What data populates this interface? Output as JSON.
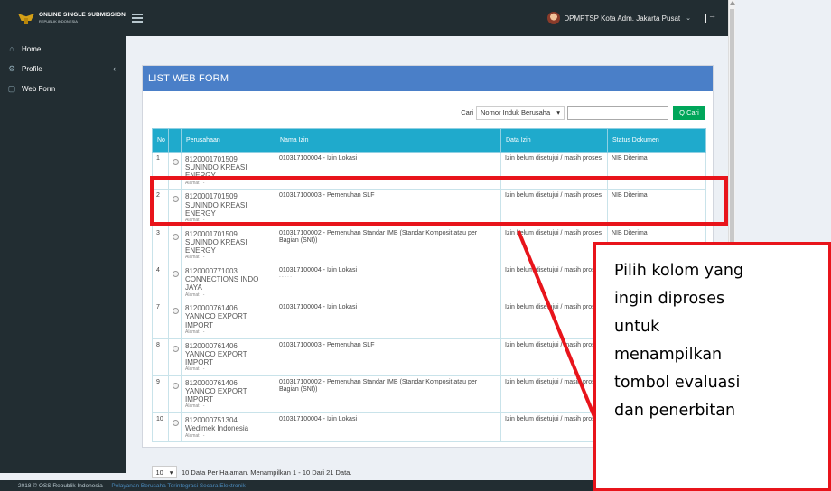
{
  "navbar": {
    "brand_title": "ONLINE SINGLE SUBMISSION",
    "brand_subtitle": "REPUBLIK INDONESIA",
    "user_name": "DPMPTSP Kota Adm. Jakarta Pusat",
    "caret": "⌄"
  },
  "sidebar": {
    "items": [
      {
        "label": "Home",
        "icon": "home-icon"
      },
      {
        "label": "Profile",
        "icon": "gear-icon"
      },
      {
        "label": "Web Form",
        "icon": "form-icon"
      }
    ]
  },
  "panel": {
    "title": "LIST WEB FORM"
  },
  "search": {
    "label": "Cari",
    "select_value": "Nomor Induk Berusaha",
    "input_value": "",
    "button_label": "Q Cari"
  },
  "table": {
    "headers": {
      "no": "No",
      "perusahaan": "Perusahaan",
      "nama_izin": "Nama Izin",
      "data_izin": "Data Izin",
      "status": "Status Dokumen"
    },
    "rows": [
      {
        "no": "1",
        "nib": "8120001701509",
        "name": "SUNINDO KREASI ENERGY",
        "alamat": "Alamat : -",
        "izin": "010317100004 - Izin Lokasi",
        "extra": "",
        "data_izin": "Izin belum disetujui / masih proses",
        "status": "NIB Diterima"
      },
      {
        "no": "2",
        "nib": "8120001701509",
        "name": "SUNINDO KREASI ENERGY",
        "alamat": "Alamat : -",
        "izin": "010317100003 - Pemenuhan SLF",
        "extra": "",
        "data_izin": "Izin belum disetujui / masih proses",
        "status": "NIB Diterima"
      },
      {
        "no": "3",
        "nib": "8120001701509",
        "name": "SUNINDO KREASI ENERGY",
        "alamat": "Alamat : -",
        "izin": "010317100002 - Pemenuhan Standar IMB (Standar Komposit atau per Bagian (SNI))",
        "extra": "",
        "data_izin": "Izin belum disetujui / masih proses",
        "status": "NIB Diterima"
      },
      {
        "no": "4",
        "nib": "8120000771003",
        "name": "CONNECTIONS INDO JAYA",
        "alamat": "Alamat : -",
        "izin": "010317100004 - Izin Lokasi",
        "extra": "- - - · ·",
        "data_izin": "Izin belum disetujui / masih proses",
        "status": ""
      },
      {
        "no": "7",
        "nib": "8120000761406",
        "name": "YANNCO EXPORT IMPORT",
        "alamat": "Alamat : -",
        "izin": "010317100004 - Izin Lokasi",
        "extra": "",
        "data_izin": "Izin belum disetujui / masih proses",
        "status": ""
      },
      {
        "no": "8",
        "nib": "8120000761406",
        "name": "YANNCO EXPORT IMPORT",
        "alamat": "Alamat : -",
        "izin": "010317100003 - Pemenuhan SLF",
        "extra": "",
        "data_izin": "Izin belum disetujui / masih proses",
        "status": ""
      },
      {
        "no": "9",
        "nib": "8120000761406",
        "name": "YANNCO EXPORT IMPORT",
        "alamat": "Alamat : -",
        "izin": "010317100002 - Pemenuhan Standar IMB (Standar Komposit atau per Bagian (SNI))",
        "extra": "",
        "data_izin": "Izin belum disetujui / masih proses",
        "status": ""
      },
      {
        "no": "10",
        "nib": "8120000751304",
        "name": "Wedimek Indonesia",
        "alamat": "Alamat : -",
        "izin": "010317100004 - Izin Lokasi",
        "extra": "",
        "data_izin": "Izin belum disetujui / masih proses",
        "status": ""
      }
    ]
  },
  "pager": {
    "page_size": "10",
    "caret": "▾",
    "summary": "10 Data Per Halaman. Menampilkan 1 - 10 Dari 21 Data.",
    "nav": "« ‹"
  },
  "footer": {
    "copyright": "2018 © OSS Republik Indonesia",
    "separator": "|",
    "link": "Pelayanan Berusaha Terintegrasi Secara Elektronik"
  },
  "annotation": {
    "lines": [
      "Pilih kolom yang",
      "ingin diproses",
      "untuk",
      "menampilkan",
      "tombol evaluasi",
      "dan penerbitan"
    ],
    "color": "#e8141b"
  }
}
